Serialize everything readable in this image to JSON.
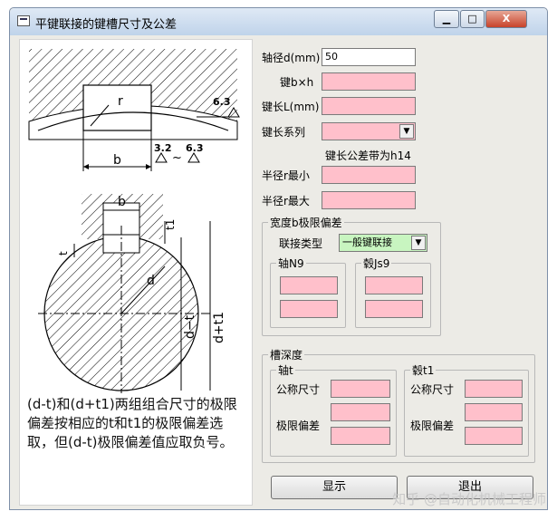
{
  "window": {
    "title": "平键联接的键槽尺寸及公差",
    "close": "X"
  },
  "drawing": {
    "labels": {
      "r1": "r",
      "b1": "b",
      "rough1": "6.3",
      "rough2": "3.2",
      "rough3": "6.3",
      "tilde": "~",
      "b2": "b",
      "t1": "t1",
      "t": "t",
      "d": "d",
      "d_minus_t": "d−t",
      "d_plus_t1": "d+t1"
    },
    "note": "(d-t)和(d+t1)两组组合尺寸的极限偏差按相应的t和t1的极限偏差选取，但(d-t)极限偏差值应取负号。"
  },
  "form": {
    "shaft_diameter": {
      "label": "轴径d(mm)",
      "value": "50"
    },
    "key_bxh": {
      "label": "键b×h",
      "value": ""
    },
    "key_length": {
      "label": "键长L(mm)",
      "value": ""
    },
    "key_length_series": {
      "label": "键长系列",
      "value": ""
    },
    "key_length_tol_note": "键长公差带为h14",
    "radius_min": {
      "label": "半径r最小",
      "value": ""
    },
    "radius_max": {
      "label": "半径r最大",
      "value": ""
    },
    "width_group": {
      "title": "宽度b极限偏差",
      "connection_label": "联接类型",
      "connection_value": "一般键联接",
      "shaft_title": "轴N9",
      "hub_title": "毂Js9",
      "shaft_values": [
        "",
        ""
      ],
      "hub_values": [
        "",
        ""
      ]
    },
    "depth_group": {
      "title": "槽深度",
      "shaft_title": "轴t",
      "hub_title": "毂t1",
      "nominal_label": "公称尺寸",
      "limit_label": "极限偏差"
    }
  },
  "buttons": {
    "show": "显示",
    "exit": "退出"
  },
  "watermark": "知乎 @自动化机械工程师",
  "colors": {
    "field_pink": "#ffc0cb",
    "combo_green": "#c8f5c0",
    "window_bg": "#ecebe6"
  }
}
